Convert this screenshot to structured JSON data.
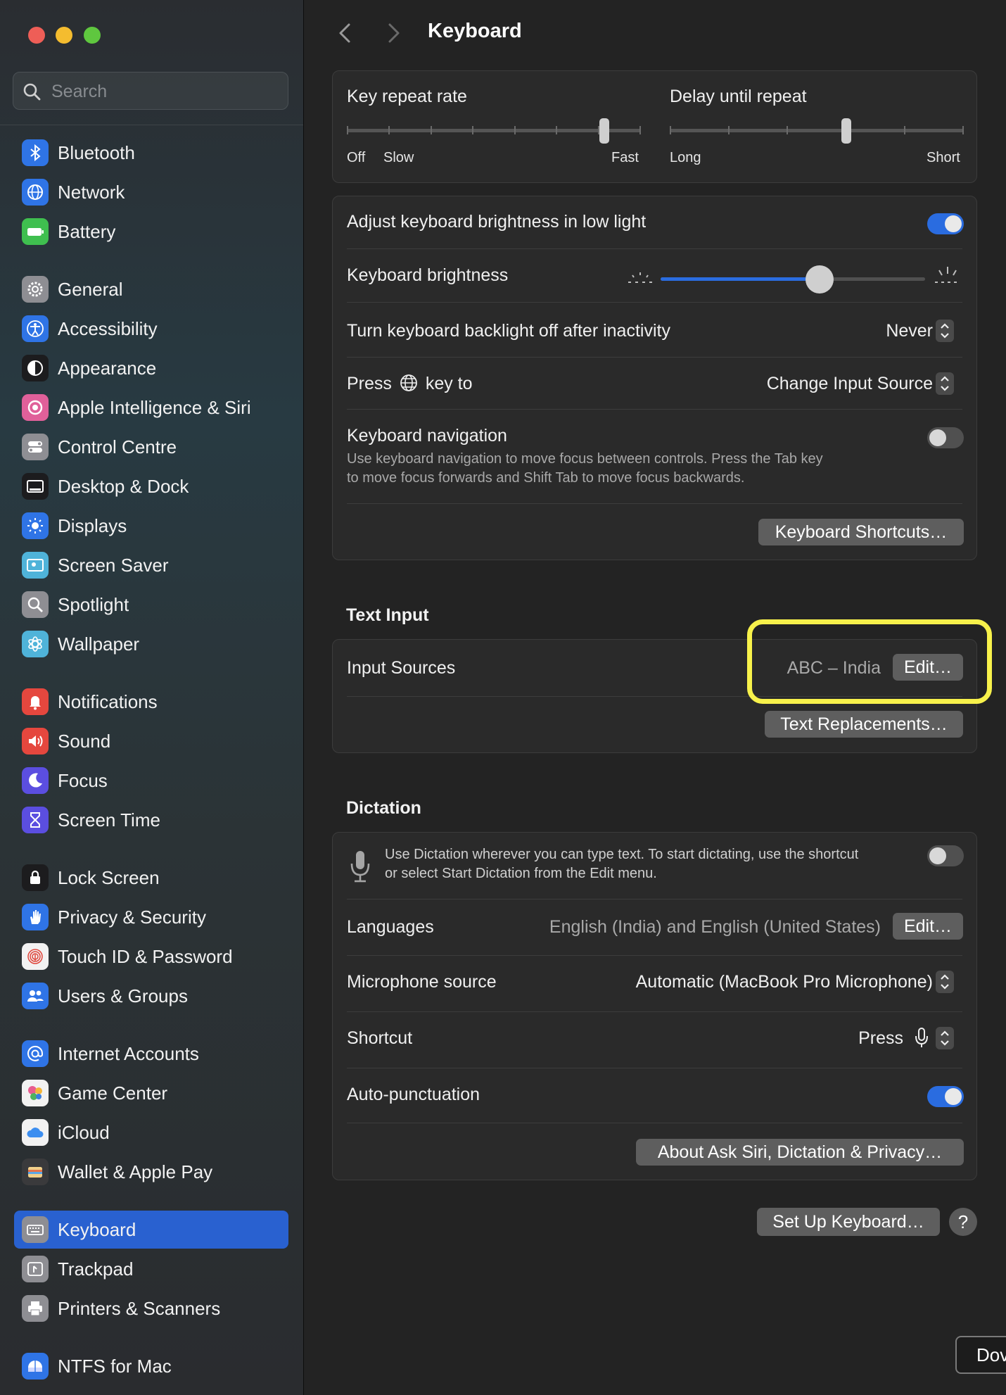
{
  "window": {
    "title": "Keyboard"
  },
  "search": {
    "placeholder": "Search"
  },
  "sidebar": {
    "items": [
      {
        "label": "Bluetooth",
        "icon": "bluetooth-icon",
        "color": "#2f74e6"
      },
      {
        "label": "Network",
        "icon": "globe-icon",
        "color": "#2f74e6"
      },
      {
        "label": "Battery",
        "icon": "battery-icon",
        "color": "#3fbf4f"
      },
      {
        "label": "General",
        "icon": "gear-icon",
        "color": "#8e8e93"
      },
      {
        "label": "Accessibility",
        "icon": "accessibility-icon",
        "color": "#2f74e6"
      },
      {
        "label": "Appearance",
        "icon": "appearance-icon",
        "color": "#1c1c1e"
      },
      {
        "label": "Apple Intelligence & Siri",
        "icon": "siri-icon",
        "color": "#e0609a"
      },
      {
        "label": "Control Centre",
        "icon": "control-centre-icon",
        "color": "#8e8e93"
      },
      {
        "label": "Desktop & Dock",
        "icon": "dock-icon",
        "color": "#1c1c1e"
      },
      {
        "label": "Displays",
        "icon": "sun-icon",
        "color": "#2f74e6"
      },
      {
        "label": "Screen Saver",
        "icon": "screen-saver-icon",
        "color": "#4fb3d9"
      },
      {
        "label": "Spotlight",
        "icon": "magnifier-icon",
        "color": "#8e8e93"
      },
      {
        "label": "Wallpaper",
        "icon": "flower-icon",
        "color": "#4fb3d9"
      },
      {
        "label": "Notifications",
        "icon": "bell-icon",
        "color": "#e5473e"
      },
      {
        "label": "Sound",
        "icon": "speaker-icon",
        "color": "#e5473e"
      },
      {
        "label": "Focus",
        "icon": "moon-icon",
        "color": "#5b4ee0"
      },
      {
        "label": "Screen Time",
        "icon": "hourglass-icon",
        "color": "#5b4ee0"
      },
      {
        "label": "Lock Screen",
        "icon": "lock-icon",
        "color": "#1c1c1e"
      },
      {
        "label": "Privacy & Security",
        "icon": "hand-icon",
        "color": "#2f74e6"
      },
      {
        "label": "Touch ID & Password",
        "icon": "fingerprint-icon",
        "color": "#f2f2f2"
      },
      {
        "label": "Users & Groups",
        "icon": "users-icon",
        "color": "#2f74e6"
      },
      {
        "label": "Internet Accounts",
        "icon": "at-icon",
        "color": "#2f74e6"
      },
      {
        "label": "Game Center",
        "icon": "game-center-icon",
        "color": "#f2f2f2"
      },
      {
        "label": "iCloud",
        "icon": "cloud-icon",
        "color": "#f2f2f2"
      },
      {
        "label": "Wallet & Apple Pay",
        "icon": "wallet-icon",
        "color": "#3a3a3c"
      },
      {
        "label": "Keyboard",
        "icon": "keyboard-icon",
        "color": "#8e8e93",
        "selected": true
      },
      {
        "label": "Trackpad",
        "icon": "trackpad-icon",
        "color": "#8e8e93"
      },
      {
        "label": "Printers & Scanners",
        "icon": "printer-icon",
        "color": "#8e8e93"
      },
      {
        "label": "NTFS for Mac",
        "icon": "ntfs-icon",
        "color": "#2f74e6"
      }
    ]
  },
  "repeat": {
    "rate_label": "Key repeat rate",
    "rate_off": "Off",
    "rate_slow": "Slow",
    "rate_fast": "Fast",
    "rate_value": 0.875,
    "delay_label": "Delay until repeat",
    "delay_long": "Long",
    "delay_short": "Short",
    "delay_value": 0.6
  },
  "backlight": {
    "adjust_label": "Adjust keyboard brightness in low light",
    "adjust_on": true,
    "brightness_label": "Keyboard brightness",
    "brightness_value": 0.6,
    "inactivity_label": "Turn keyboard backlight off after inactivity",
    "inactivity_value": "Never",
    "press_label_pre": "Press",
    "press_label_post": "key to",
    "press_value": "Change Input Source",
    "nav_label": "Keyboard navigation",
    "nav_desc_1": "Use keyboard navigation to move focus between controls. Press the Tab key",
    "nav_desc_2": "to move focus forwards and Shift Tab to move focus backwards.",
    "nav_on": false,
    "shortcuts_button": "Keyboard Shortcuts…"
  },
  "text_input": {
    "section_title": "Text Input",
    "sources_label": "Input Sources",
    "sources_value": "ABC – India",
    "edit_button": "Edit…",
    "replacements_button": "Text Replacements…",
    "highlight_color": "#f7f14b"
  },
  "dictation": {
    "section_title": "Dictation",
    "desc_1": "Use Dictation wherever you can type text. To start dictating, use the shortcut",
    "desc_2": "or select Start Dictation from the Edit menu.",
    "dictation_on": false,
    "languages_label": "Languages",
    "languages_value": "English (India) and English (United States)",
    "languages_edit": "Edit…",
    "mic_label": "Microphone source",
    "mic_value": "Automatic (MacBook Pro Microphone)",
    "shortcut_label": "Shortcut",
    "shortcut_value": "Press",
    "autopunct_label": "Auto-punctuation",
    "autopunct_on": true,
    "about_button": "About Ask Siri, Dictation & Privacy…"
  },
  "footer": {
    "setup_button": "Set Up Keyboard…",
    "help_button": "?",
    "dow_button": "Dov"
  }
}
